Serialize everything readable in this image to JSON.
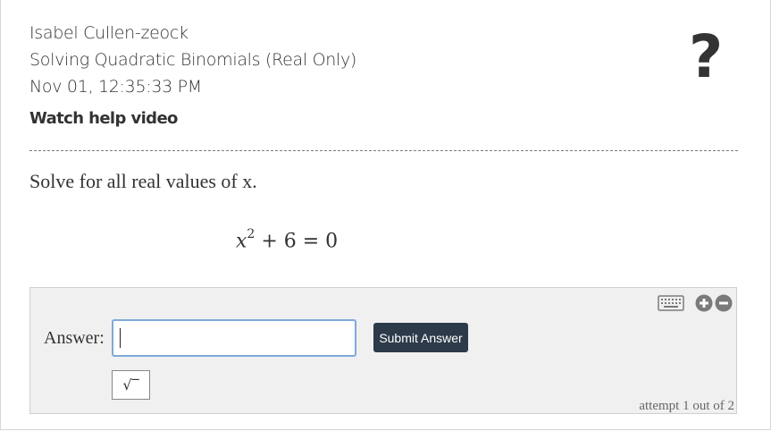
{
  "header": {
    "student_name": "Isabel Cullen-zeock",
    "topic": "Solving Quadratic Binomials (Real Only)",
    "timestamp": "Nov 01, 12:35:33 PM",
    "help_link": "Watch help video",
    "help_icon": "?"
  },
  "question": {
    "prompt": "Solve for all real values of x.",
    "equation": {
      "variable": "x",
      "exponent": "2",
      "rest": " + 6 = 0"
    }
  },
  "answer": {
    "label": "Answer:",
    "input_value": "",
    "submit_label": "Submit Answer",
    "sqrt_button_label": "√‾",
    "attempt_text": "attempt 1 out of 2",
    "icons": [
      "keyboard-icon",
      "zoom-in-icon",
      "zoom-out-icon"
    ]
  },
  "colors": {
    "submit_bg": "#2d3a4a",
    "input_border": "#7fa9d9",
    "panel_bg": "#f0f0f0",
    "icon_gray": "#7a7a7a"
  }
}
